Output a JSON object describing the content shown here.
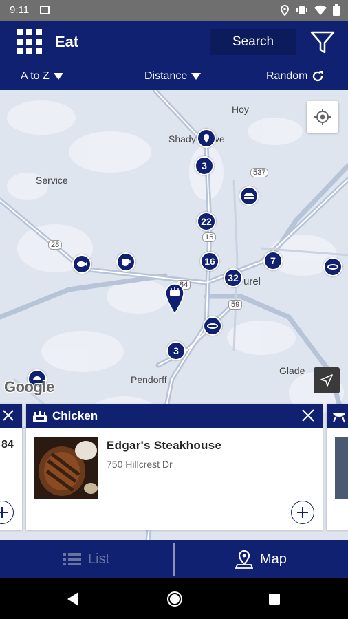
{
  "status_bar": {
    "time": "9:11"
  },
  "header": {
    "title": "Eat",
    "search_label": "Search"
  },
  "sort_bar": {
    "a_to_z": "A to Z",
    "distance": "Distance",
    "random": "Random"
  },
  "map": {
    "places": [
      "Hoy",
      "Shady",
      "ve",
      "Service",
      "urel",
      "Pendorff",
      "Glade"
    ],
    "road_shields": [
      "537",
      "15",
      "28",
      "84",
      "59"
    ],
    "cluster_counts": [
      "3",
      "22",
      "16",
      "32",
      "7",
      "3"
    ],
    "attribution": "Google"
  },
  "cards": [
    {
      "partial_text": "84"
    },
    {
      "category": "Chicken",
      "name": "Edgar's Steakhouse",
      "address": "750 Hillcrest Dr"
    }
  ],
  "tabs": {
    "list": "List",
    "map": "Map"
  },
  "colors": {
    "brand": "#0f2170",
    "map_bg": "#dfe5ee",
    "road": "#b7c3d6"
  }
}
